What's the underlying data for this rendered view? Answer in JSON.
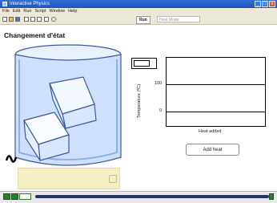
{
  "window": {
    "title": "Interactive Physics",
    "controls": [
      "_",
      "□",
      "x"
    ]
  },
  "menubar": {
    "items": [
      "File",
      "Edit",
      "Run",
      "Script",
      "Window",
      "Help"
    ]
  },
  "toolbar": {
    "icons": [
      "new-file-icon",
      "open-folder-icon",
      "save-icon",
      "cut-icon",
      "copy-icon",
      "paste-icon",
      "print-icon",
      "help-icon"
    ],
    "run_label": "Run",
    "status_text": "Heat Mode"
  },
  "content": {
    "heading": "Changement d'état"
  },
  "graph": {
    "y_label": "Temperature (ºC)",
    "x_label": "Heat added",
    "y_ticks": [
      "100",
      "0"
    ]
  },
  "buttons": {
    "add_heat": "Add heat"
  },
  "colors": {
    "water": "#cfe0ff",
    "beaker_outline": "#3a5aa0",
    "heater_panel": "#f7efc4",
    "playback": "#2f7a2f",
    "track": "#23336e"
  }
}
